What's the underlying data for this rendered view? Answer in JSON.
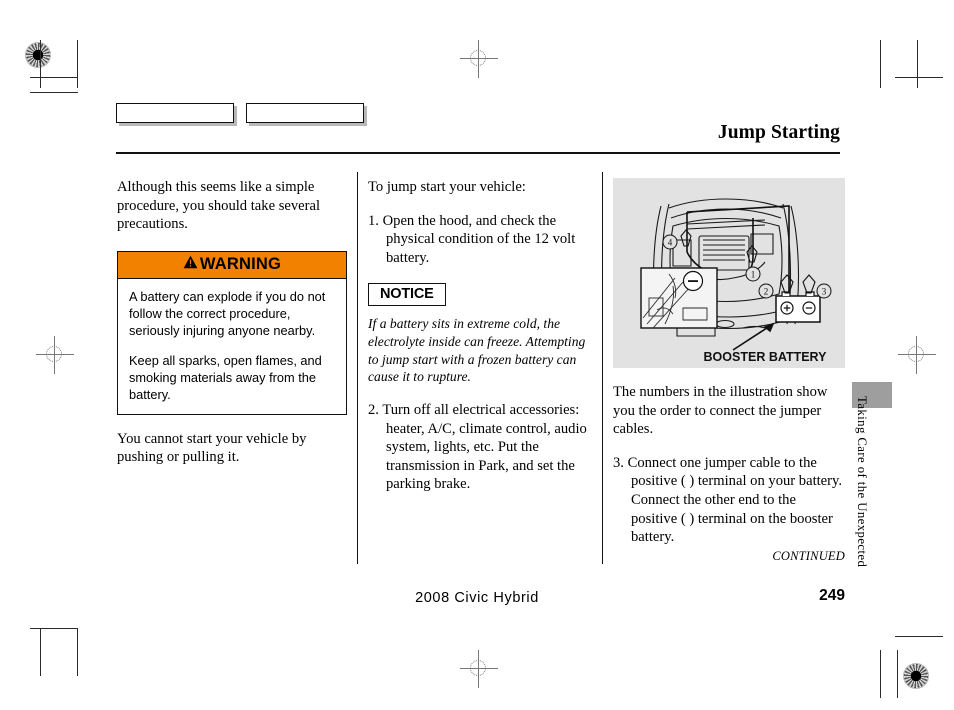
{
  "document": {
    "title": "Jump Starting",
    "footer_model": "2008  Civic  Hybrid",
    "page_number": "249",
    "continued_label": "CONTINUED",
    "side_tab_label": "Taking Care of the Unexpected"
  },
  "colors": {
    "warning_orange": "#f28100",
    "illustration_background": "#e2e2e2",
    "side_marker_gray": "#9e9e9e",
    "rule_black": "#111111"
  },
  "left_column": {
    "intro": "Although this seems like a simple procedure, you should take several precautions.",
    "warning": {
      "heading": "WARNING",
      "paragraphs": [
        "A battery can explode if you do not follow the correct procedure, seriously injuring anyone nearby.",
        "Keep all sparks, open flames, and smoking materials away from the battery."
      ]
    },
    "closing": "You cannot start your vehicle by pushing or pulling it."
  },
  "middle_column": {
    "lead_in": "To jump start your vehicle:",
    "step_1": {
      "number": "1.",
      "text": "Open the hood, and check the physical condition of the 12 volt battery."
    },
    "notice": {
      "heading": "NOTICE",
      "text": "If a battery sits in extreme cold, the electrolyte inside can freeze. Attempting to jump start with a frozen battery can cause it to rupture."
    },
    "step_2": {
      "number": "2.",
      "text": "Turn off all electrical accessories: heater, A/C, climate control, audio system, lights, etc. Put the transmission in Park, and set the parking brake."
    }
  },
  "right_column": {
    "illustration_caption": "BOOSTER BATTERY",
    "callout_numbers": [
      "1",
      "2",
      "3",
      "4"
    ],
    "terminal_symbols": {
      "positive": "+",
      "negative": "-"
    },
    "note": "The numbers in the illustration show you the order to connect the jumper cables.",
    "step_3": {
      "number": "3.",
      "text": "Connect one jumper cable to the positive (  ) terminal on your battery. Connect the other end to the positive (  ) terminal on the booster battery."
    }
  }
}
